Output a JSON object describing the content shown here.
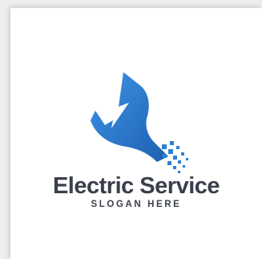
{
  "logo": {
    "brand_name": "Electric Service",
    "slogan": "SLOGAN HERE",
    "icon": "wrench-lightning-icon",
    "colors": {
      "text": "#3a3f4b",
      "accent": "#2f7fd3",
      "accent_dark": "#1d5fb0",
      "background": "#ffffff",
      "page": "#eeeeee"
    }
  }
}
